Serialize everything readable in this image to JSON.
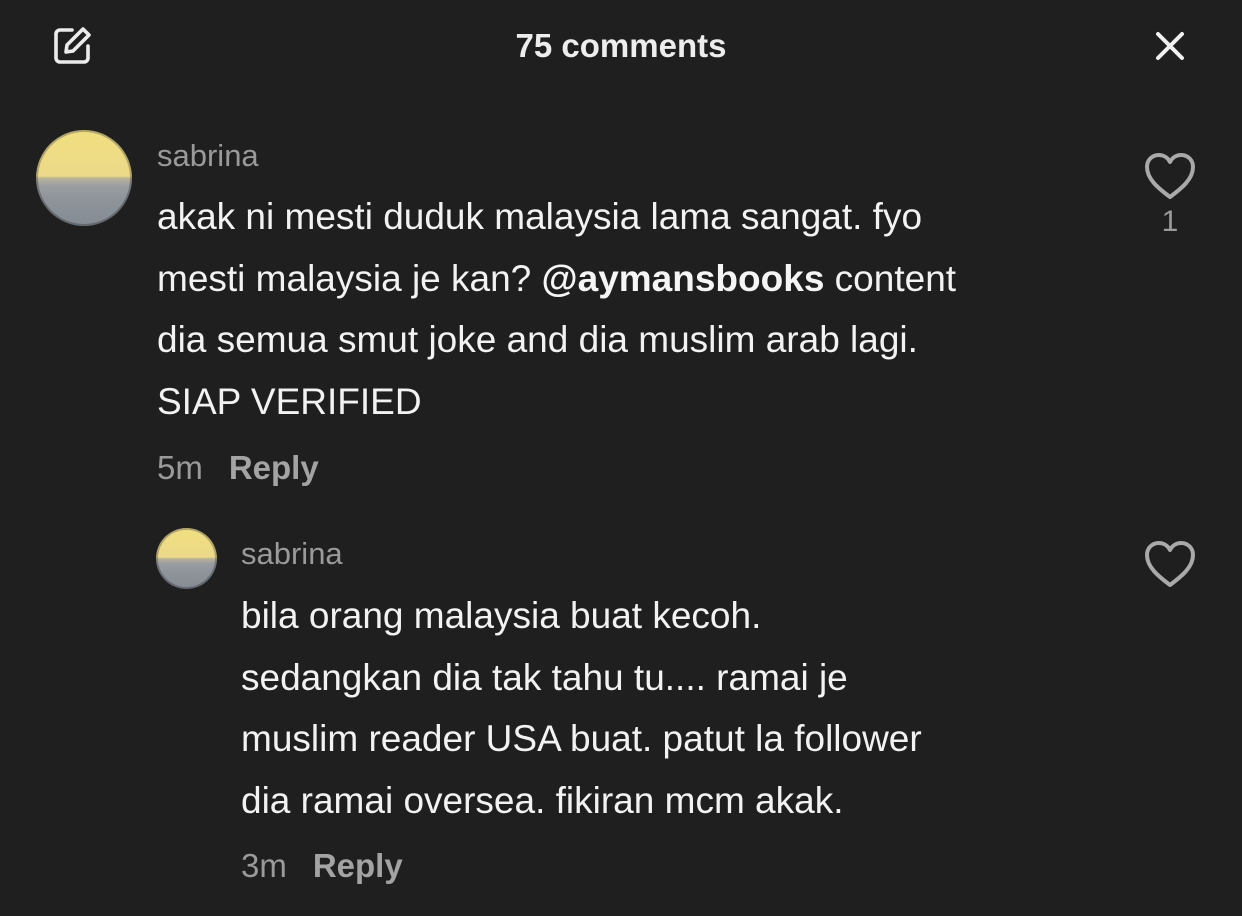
{
  "header": {
    "title": "75 comments",
    "edit_icon": "edit-icon",
    "close_icon": "close-icon"
  },
  "comments": [
    {
      "username": "sabrina",
      "text_lines": [
        "akak ni mesti duduk malaysia lama sangat. fyo",
        "mesti malaysia je kan?",
        "@aymansbooks",
        " content",
        "dia semua smut joke and dia muslim arab lagi.",
        "SIAP VERIFIED"
      ],
      "time": "5m",
      "reply_label": "Reply",
      "like_count": "1",
      "like_icon": "heart-outline-icon"
    },
    {
      "username": "sabrina",
      "text_lines": [
        "bila orang malaysia buat kecoh.",
        "sedangkan dia tak tahu tu.... ramai je",
        "muslim reader USA buat. patut la follower",
        "dia ramai oversea. fikiran mcm akak."
      ],
      "time": "3m",
      "reply_label": "Reply",
      "like_count": "",
      "like_icon": "heart-outline-icon"
    }
  ]
}
